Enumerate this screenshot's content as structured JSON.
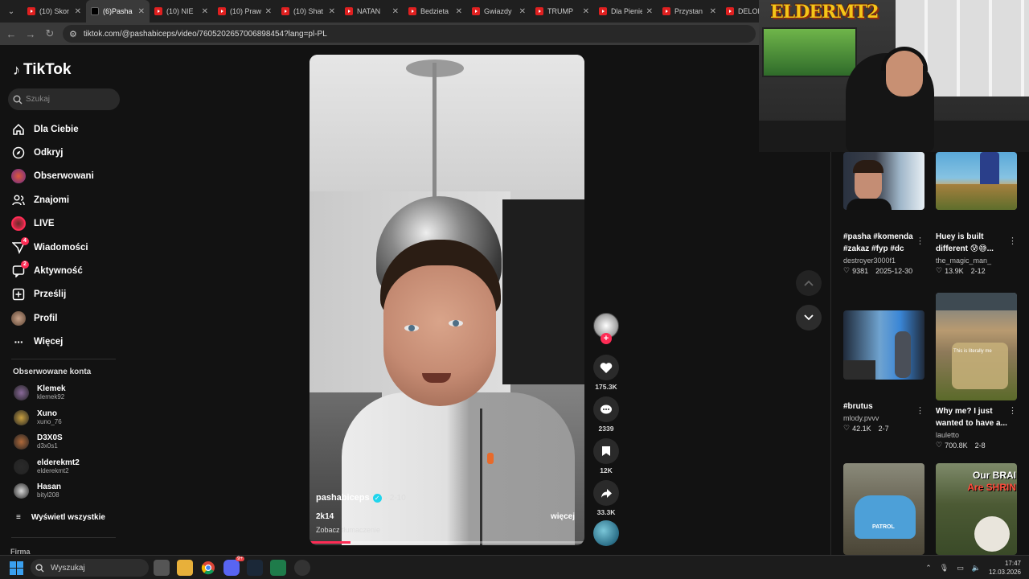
{
  "browser": {
    "tabs": [
      {
        "label": "(10) Skor",
        "icon": "youtube-icon"
      },
      {
        "label": "(6)Pasha",
        "icon": "tiktok-icon",
        "active": true
      },
      {
        "label": "(10) NIE",
        "icon": "youtube-icon"
      },
      {
        "label": "(10) Praw",
        "icon": "youtube-icon"
      },
      {
        "label": "(10) Shat",
        "icon": "youtube-icon"
      },
      {
        "label": "NATAN",
        "icon": "youtube-icon"
      },
      {
        "label": "Bedzieta",
        "icon": "youtube-icon"
      },
      {
        "label": "Gwiazdy",
        "icon": "youtube-icon"
      },
      {
        "label": "TRUMP",
        "icon": "youtube-icon"
      },
      {
        "label": "Dla Pienie",
        "icon": "youtube-icon"
      },
      {
        "label": "Przystan",
        "icon": "youtube-icon"
      },
      {
        "label": "DELOR",
        "icon": "youtube-icon"
      }
    ],
    "url": "tiktok.com/@pashabiceps/video/7605202657006898454?lang=pl-PL"
  },
  "sidebar": {
    "logo": "TikTok",
    "search_placeholder": "Szukaj",
    "nav": [
      {
        "label": "Dla Ciebie",
        "icon": "home-icon"
      },
      {
        "label": "Odkryj",
        "icon": "compass-icon"
      },
      {
        "label": "Obserwowani",
        "icon": "following-avatar-icon"
      },
      {
        "label": "Znajomi",
        "icon": "friends-icon"
      },
      {
        "label": "LIVE",
        "icon": "live-icon"
      },
      {
        "label": "Wiadomości",
        "icon": "messages-icon",
        "badge": "4"
      },
      {
        "label": "Aktywność",
        "icon": "activity-icon",
        "badge": "2"
      },
      {
        "label": "Prześlij",
        "icon": "upload-icon"
      },
      {
        "label": "Profil",
        "icon": "profile-avatar-icon"
      },
      {
        "label": "Więcej",
        "icon": "more-dots-icon"
      }
    ],
    "following_title": "Obserwowane konta",
    "following": [
      {
        "name": "Klemek",
        "handle": "klemek92",
        "color": "#8a6a9a"
      },
      {
        "name": "Xuno",
        "handle": "xuno_76",
        "color": "#c9a040"
      },
      {
        "name": "D3X0S",
        "handle": "d3x0s1",
        "color": "#b06a3a"
      },
      {
        "name": "elderekmt2",
        "handle": "elderekmt2",
        "color": "#2a2a2a"
      },
      {
        "name": "Hasan",
        "handle": "bityl208",
        "color": "#d8d8d8"
      }
    ],
    "show_all": "Wyświetl wszystkie",
    "footer": "Firma"
  },
  "video": {
    "author": "pashabiceps",
    "date": "· 2-10",
    "caption": "2k14",
    "more": "więcej",
    "translate": "Zobacz tłumaczenie",
    "progress": 0.15
  },
  "actions": {
    "likes": "175.3K",
    "comments": "2339",
    "saves": "12K",
    "shares": "33.3K",
    "follow": "+"
  },
  "feed": [
    {
      "title": "#pasha #komenda #zakaz #fyp #dc",
      "author": "destroyer3000f1",
      "likes": "9381",
      "date": "2025-12-30"
    },
    {
      "title": "Huey is built different 😰😅...",
      "author": "the_magic_man_",
      "likes": "13.9K",
      "date": "2-12"
    },
    {
      "title": "#brutus",
      "author": "mlody.pvvv",
      "likes": "42.1K",
      "date": "2-7"
    },
    {
      "title": "Why me? I just wanted to have a...",
      "author": "lauletto",
      "likes": "700.8K",
      "date": "2-8"
    },
    {
      "thumb_text": "PATROL"
    },
    {
      "thumb_text": "Our BRAI Are SHRIN"
    }
  ],
  "feed_thumb_text": {
    "car": "PATROL",
    "brain_line1": "Our BRAI",
    "brain_line2": "Are SHRIN",
    "literally": "This is literally me"
  },
  "webcam": {
    "logo": "ELDERMT2"
  },
  "taskbar": {
    "search": "Wyszukaj",
    "time": "17:47",
    "date": "12.03.2026",
    "discord_badge": "9+"
  }
}
